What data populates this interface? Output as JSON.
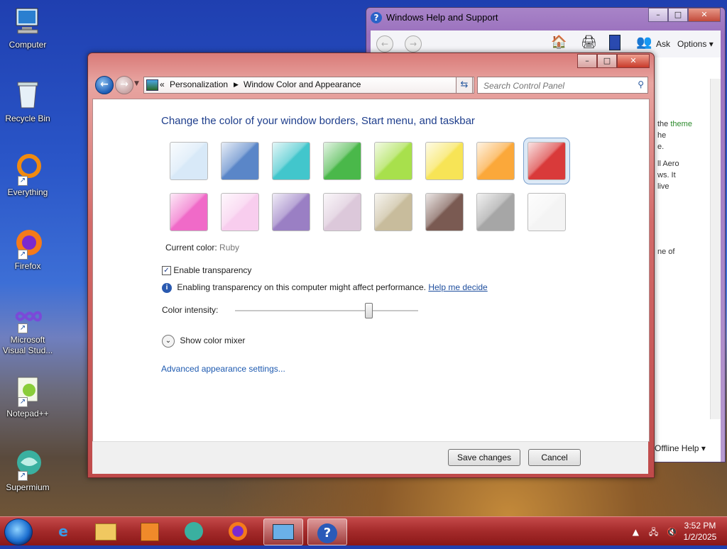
{
  "desktop": {
    "icons": [
      {
        "label": "Computer"
      },
      {
        "label": "Recycle Bin"
      },
      {
        "label": "Everything"
      },
      {
        "label": "Firefox"
      },
      {
        "label": "Microsoft Visual Stud..."
      },
      {
        "label": "Notepad++"
      },
      {
        "label": "Supermium"
      }
    ]
  },
  "help_window": {
    "title": "Windows Help and Support",
    "ask_label": "Ask",
    "options_label": "Options",
    "text_frag_theme": "the",
    "text_frag_theme_link": "theme",
    "text_frag_2": "he",
    "text_frag_3": "e.",
    "text_frag_4": "ll Aero",
    "text_frag_5": "ws. It",
    "text_frag_6": "live",
    "text_frag_7": "ne of",
    "offline_help": "Offline Help"
  },
  "main_window": {
    "breadcrumb_root": "Personalization",
    "breadcrumb_current": "Window Color and Appearance",
    "search_placeholder": "Search Control Panel",
    "heading": "Change the color of your window borders, Start menu, and taskbar",
    "swatches": [
      {
        "color": "#d8e9f8"
      },
      {
        "color": "#5a86c8"
      },
      {
        "color": "#42c6cc"
      },
      {
        "color": "#4ab84a"
      },
      {
        "color": "#a8e04c"
      },
      {
        "color": "#f7e456"
      },
      {
        "color": "#fba83a"
      },
      {
        "color": "#d93a3a"
      },
      {
        "color": "#f06ac8"
      },
      {
        "color": "#f8cdee"
      },
      {
        "color": "#9a7fc4"
      },
      {
        "color": "#dcc8da"
      },
      {
        "color": "#c8bc9c"
      },
      {
        "color": "#7a5a52"
      },
      {
        "color": "#a6a6a6"
      },
      {
        "color": "#f4f4f4"
      }
    ],
    "selected_swatch_index": 7,
    "current_color_label": "Current color:",
    "current_color_value": "Ruby",
    "enable_transparency_label": "Enable transparency",
    "enable_transparency_checked": true,
    "info_text": "Enabling transparency on this computer might affect performance.",
    "help_link": "Help me decide",
    "intensity_label": "Color intensity:",
    "intensity_value": 0.73,
    "mixer_label": "Show color mixer",
    "advanced_link": "Advanced appearance settings...",
    "save_button": "Save changes",
    "cancel_button": "Cancel"
  },
  "taskbar": {
    "time": "3:52 PM",
    "date": "1/2/2025"
  }
}
